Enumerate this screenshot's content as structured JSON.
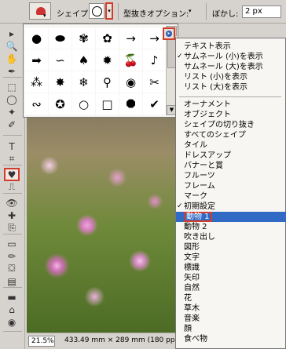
{
  "options_bar": {
    "shape_label": "シェイプ:",
    "clip_option_label": "型抜きオプション:",
    "blur_label": "ぼかし:",
    "blur_value": "2 px"
  },
  "status_bar": {
    "zoom": "21.5%",
    "document_size": "433.49 mm × 289 mm (180 ppi)"
  },
  "shape_picker": {
    "icons": [
      "speech-bubble-round",
      "speech-bubble-oval",
      "butterfly",
      "paw-print",
      "arrow-right-thin",
      "arrow-right-thin-2",
      "arrow-right-bold",
      "tilde-wave",
      "leaf",
      "sunburst-box",
      "cherries",
      "music-note",
      "grass",
      "burst",
      "snowflake",
      "lightbulb",
      "eye",
      "scissors",
      "ornament-swirl",
      "ornament-circle",
      "circle-outline",
      "square-outline",
      "octagon-filled",
      "check-mark"
    ],
    "glyphs": [
      "●",
      "⬬",
      "✾",
      "✿",
      "→",
      "→",
      "➡",
      "∽",
      "♠",
      "✹",
      "🍒",
      "♪",
      "⁂",
      "✸",
      "❄",
      "⚲",
      "◉",
      "✂",
      "∾",
      "✪",
      "○",
      "□",
      "⯃",
      "✔"
    ]
  },
  "menu": {
    "view_items": [
      {
        "label": "テキスト表示",
        "checked": false
      },
      {
        "label": "サムネール (小)を表示",
        "checked": true
      },
      {
        "label": "サムネール (大)を表示",
        "checked": false
      },
      {
        "label": "リスト (小)を表示",
        "checked": false
      },
      {
        "label": "リスト (大)を表示",
        "checked": false
      }
    ],
    "category_items": [
      {
        "label": "オーナメント",
        "checked": false
      },
      {
        "label": "オブジェクト",
        "checked": false
      },
      {
        "label": "シェイプの切り抜き",
        "checked": false
      },
      {
        "label": "すべてのシェイプ",
        "checked": false
      },
      {
        "label": "タイル",
        "checked": false
      },
      {
        "label": "ドレスアップ",
        "checked": false
      },
      {
        "label": "バナーと賞",
        "checked": false
      },
      {
        "label": "フルーツ",
        "checked": false
      },
      {
        "label": "フレーム",
        "checked": false
      },
      {
        "label": "マーク",
        "checked": false
      },
      {
        "label": "初期設定",
        "checked": true
      },
      {
        "label": "動物 1",
        "checked": false,
        "highlighted": true
      },
      {
        "label": "動物 2",
        "checked": false
      },
      {
        "label": "吹き出し",
        "checked": false
      },
      {
        "label": "図形",
        "checked": false
      },
      {
        "label": "文字",
        "checked": false
      },
      {
        "label": "標識",
        "checked": false
      },
      {
        "label": "矢印",
        "checked": false
      },
      {
        "label": "自然",
        "checked": false
      },
      {
        "label": "花",
        "checked": false
      },
      {
        "label": "草木",
        "checked": false
      },
      {
        "label": "音楽",
        "checked": false
      },
      {
        "label": "顔",
        "checked": false
      },
      {
        "label": "食べ物",
        "checked": false
      }
    ]
  },
  "toolbox": {
    "tools": [
      "move-tool",
      "zoom-tool",
      "hand-tool",
      "eyedropper-tool",
      "marquee-tool",
      "lasso-tool",
      "magic-wand-tool",
      "selection-brush-tool",
      "type-tool",
      "crop-tool",
      "cookie-cutter-tool",
      "straighten-tool",
      "red-eye-tool",
      "healing-brush-tool",
      "clone-stamp-tool",
      "eraser-tool",
      "pencil-tool",
      "paint-bucket-tool",
      "gradient-tool",
      "shape-tool",
      "blur-tool",
      "sponge-tool"
    ],
    "glyphs": [
      "▸",
      "🔍",
      "✋",
      "✒",
      "⬚",
      "◯",
      "✦",
      "✐",
      "T",
      "⌗",
      "♥",
      "⎍",
      "👁",
      "✚",
      "⎘",
      "▭",
      "✏",
      "⛋",
      "▤",
      "▬",
      "⌂",
      "◉"
    ]
  },
  "colors": {
    "highlight": "#316ac5",
    "callout": "#d23c2a"
  }
}
